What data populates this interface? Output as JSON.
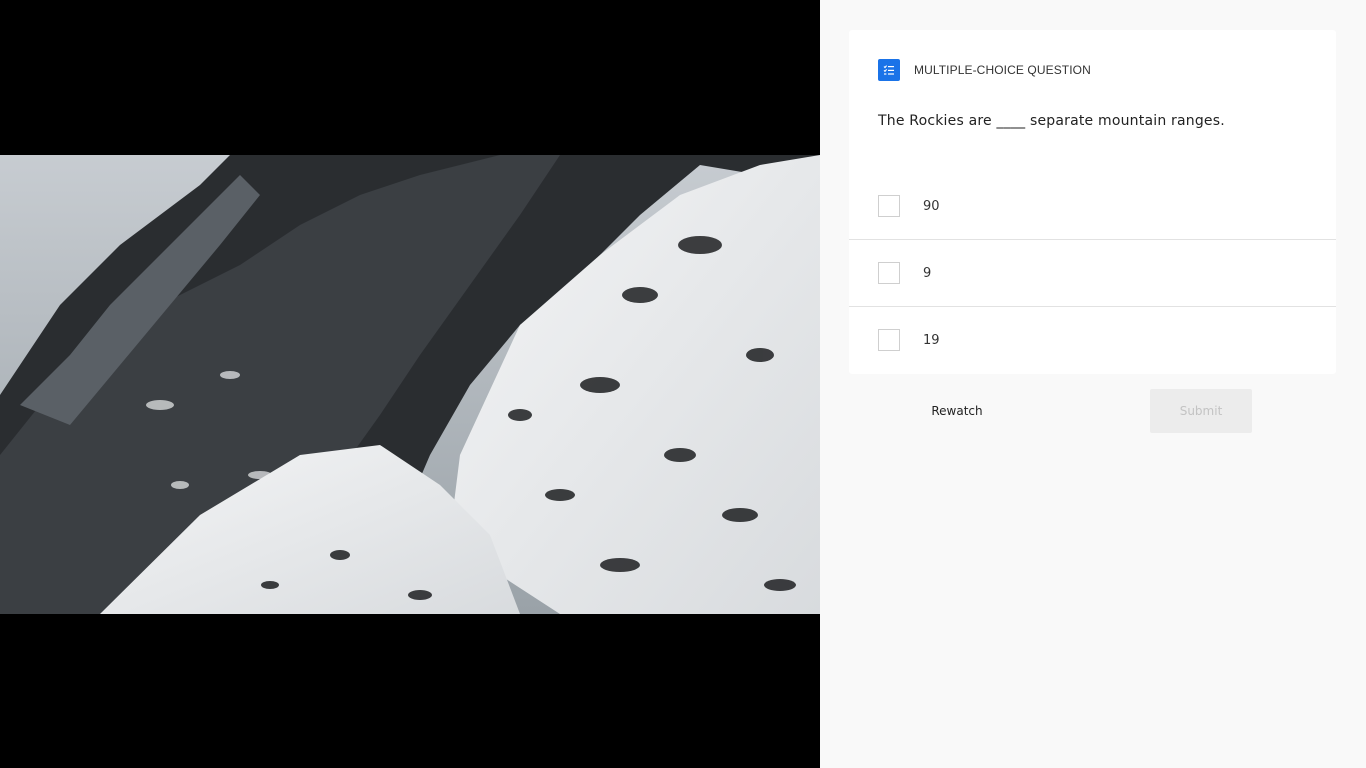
{
  "quiz": {
    "header_label": "MULTIPLE-CHOICE QUESTION",
    "header_icon": "checklist-icon",
    "accent_color": "#1a73e8",
    "question": "The Rockies are ____ separate mountain ranges.",
    "options": [
      {
        "label": "90",
        "checked": false
      },
      {
        "label": "9",
        "checked": false
      },
      {
        "label": "19",
        "checked": false
      }
    ],
    "rewatch_label": "Rewatch",
    "submit_label": "Submit",
    "submit_enabled": false
  }
}
